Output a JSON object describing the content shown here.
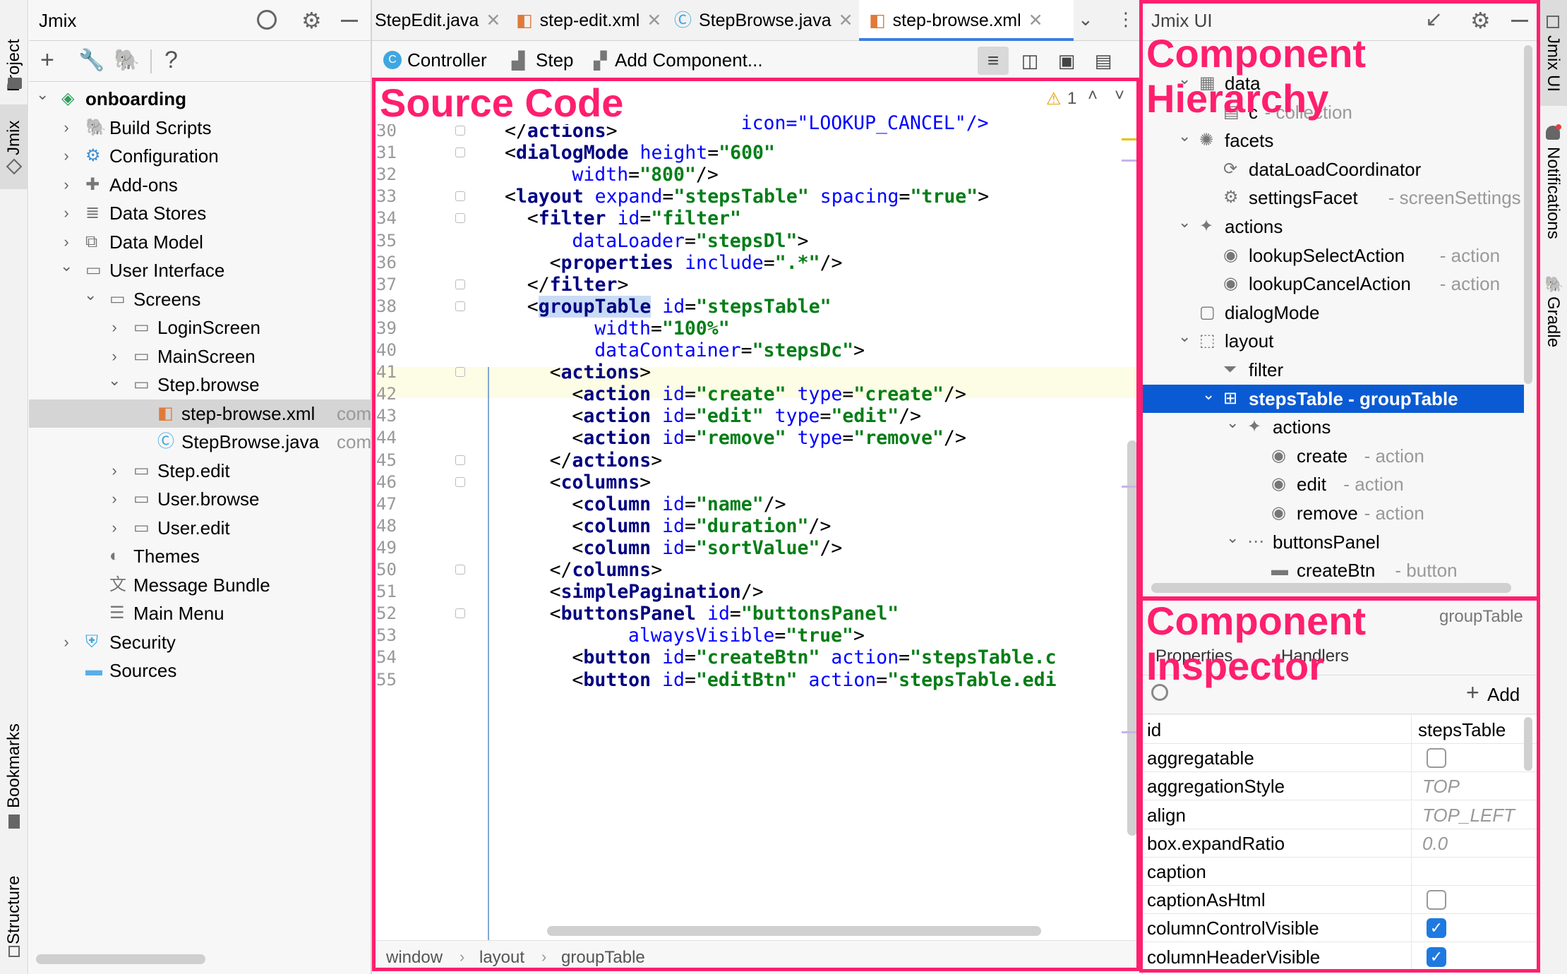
{
  "sidebar_left": {
    "project": "Project",
    "jmix": "Jmix",
    "bookmarks": "Bookmarks",
    "structure": "Structure"
  },
  "sidebar_right": {
    "jmix_ui": "Jmix UI",
    "notifications": "Notifications",
    "gradle": "Gradle"
  },
  "project_panel": {
    "title": "Jmix",
    "toolbar_help": "?",
    "tree": [
      {
        "label": "onboarding",
        "bold": true,
        "level": 0,
        "expanded": true,
        "icon": "project-icon"
      },
      {
        "label": "Build Scripts",
        "level": 1,
        "expanded": false,
        "icon": "gradle-icon"
      },
      {
        "label": "Configuration",
        "level": 1,
        "expanded": false,
        "icon": "config-icon"
      },
      {
        "label": "Add-ons",
        "level": 1,
        "expanded": false,
        "icon": "puzzle-icon"
      },
      {
        "label": "Data Stores",
        "level": 1,
        "expanded": false,
        "icon": "database-icon"
      },
      {
        "label": "Data Model",
        "level": 1,
        "expanded": false,
        "icon": "model-icon"
      },
      {
        "label": "User Interface",
        "level": 1,
        "expanded": true,
        "icon": "ui-icon"
      },
      {
        "label": "Screens",
        "level": 2,
        "expanded": true,
        "icon": "screen-icon"
      },
      {
        "label": "LoginScreen",
        "level": 3,
        "expanded": false,
        "icon": "screen-icon"
      },
      {
        "label": "MainScreen",
        "level": 3,
        "expanded": false,
        "icon": "screen-icon"
      },
      {
        "label": "Step.browse",
        "level": 3,
        "expanded": true,
        "icon": "screen-icon"
      },
      {
        "label": "step-browse.xml",
        "suffix": "com",
        "level": 4,
        "icon": "xml-icon",
        "selected": true
      },
      {
        "label": "StepBrowse.java",
        "suffix": "com",
        "level": 4,
        "icon": "class-icon"
      },
      {
        "label": "Step.edit",
        "level": 3,
        "expanded": false,
        "icon": "screen-icon"
      },
      {
        "label": "User.browse",
        "level": 3,
        "expanded": false,
        "icon": "screen-icon"
      },
      {
        "label": "User.edit",
        "level": 3,
        "expanded": false,
        "icon": "screen-icon"
      },
      {
        "label": "Themes",
        "level": 2,
        "icon": "themes-icon"
      },
      {
        "label": "Message Bundle",
        "level": 2,
        "icon": "translate-icon"
      },
      {
        "label": "Main Menu",
        "level": 2,
        "icon": "menu-icon"
      },
      {
        "label": "Security",
        "level": 1,
        "expanded": false,
        "icon": "shield-icon"
      },
      {
        "label": "Sources",
        "level": 1,
        "icon": "folder-icon"
      }
    ]
  },
  "editor_tabs": [
    {
      "label": "StepEdit.java",
      "icon": "class-icon"
    },
    {
      "label": "step-edit.xml",
      "icon": "xml-icon"
    },
    {
      "label": "StepBrowse.java",
      "icon": "class-icon"
    },
    {
      "label": "step-browse.xml",
      "icon": "xml-icon",
      "active": true
    }
  ],
  "editor_toolbar": {
    "controller": "Controller",
    "step": "Step",
    "add_component": "Add Component..."
  },
  "editor": {
    "warnings": "1",
    "top_fragment": "icon=\"LOOKUP_CANCEL\"/>",
    "lines": [
      {
        "n": "30",
        "indent": 0,
        "parts": [
          [
            "p",
            "</"
          ],
          [
            "t",
            "actions"
          ],
          [
            "p",
            ">"
          ]
        ]
      },
      {
        "n": "31",
        "indent": 0,
        "parts": [
          [
            "p",
            "<"
          ],
          [
            "t",
            "dialogMode"
          ],
          [
            "p",
            " "
          ],
          [
            "a",
            "height"
          ],
          [
            "p",
            "="
          ],
          [
            "v",
            "\"600\""
          ]
        ]
      },
      {
        "n": "32",
        "indent": 6,
        "parts": [
          [
            "a",
            "width"
          ],
          [
            "p",
            "="
          ],
          [
            "v",
            "\"800\""
          ],
          [
            "p",
            "/>"
          ]
        ]
      },
      {
        "n": "33",
        "indent": 0,
        "parts": [
          [
            "p",
            "<"
          ],
          [
            "t",
            "layout"
          ],
          [
            "p",
            " "
          ],
          [
            "a",
            "expand"
          ],
          [
            "p",
            "="
          ],
          [
            "v",
            "\"stepsTable\""
          ],
          [
            "p",
            " "
          ],
          [
            "a",
            "spacing"
          ],
          [
            "p",
            "="
          ],
          [
            "v",
            "\"true\""
          ],
          [
            "p",
            ">"
          ]
        ]
      },
      {
        "n": "34",
        "indent": 2,
        "parts": [
          [
            "p",
            "<"
          ],
          [
            "t",
            "filter"
          ],
          [
            "p",
            " "
          ],
          [
            "a",
            "id"
          ],
          [
            "p",
            "="
          ],
          [
            "v",
            "\"filter\""
          ]
        ]
      },
      {
        "n": "35",
        "indent": 6,
        "parts": [
          [
            "a",
            "dataLoader"
          ],
          [
            "p",
            "="
          ],
          [
            "v",
            "\"stepsDl\""
          ],
          [
            "p",
            ">"
          ]
        ]
      },
      {
        "n": "36",
        "indent": 4,
        "parts": [
          [
            "p",
            "<"
          ],
          [
            "t",
            "properties"
          ],
          [
            "p",
            " "
          ],
          [
            "a",
            "include"
          ],
          [
            "p",
            "="
          ],
          [
            "v",
            "\".*\""
          ],
          [
            "p",
            "/>"
          ]
        ]
      },
      {
        "n": "37",
        "indent": 2,
        "parts": [
          [
            "p",
            "</"
          ],
          [
            "t",
            "filter"
          ],
          [
            "p",
            ">"
          ]
        ]
      },
      {
        "n": "38",
        "indent": 2,
        "parts": [
          [
            "p",
            "<"
          ],
          [
            "t",
            "groupTable"
          ],
          [
            "p",
            " "
          ],
          [
            "a",
            "id"
          ],
          [
            "p",
            "="
          ],
          [
            "v",
            "\"stepsTable\""
          ]
        ]
      },
      {
        "n": "39",
        "indent": 8,
        "parts": [
          [
            "a",
            "width"
          ],
          [
            "p",
            "="
          ],
          [
            "v",
            "\"100%\""
          ]
        ]
      },
      {
        "n": "40",
        "indent": 8,
        "parts": [
          [
            "a",
            "dataContainer"
          ],
          [
            "p",
            "="
          ],
          [
            "v",
            "\"stepsDc\""
          ],
          [
            "p",
            ">"
          ]
        ]
      },
      {
        "n": "41",
        "indent": 4,
        "parts": [
          [
            "p",
            "<"
          ],
          [
            "t",
            "actions"
          ],
          [
            "p",
            ">"
          ]
        ]
      },
      {
        "n": "42",
        "indent": 6,
        "parts": [
          [
            "p",
            "<"
          ],
          [
            "t",
            "action"
          ],
          [
            "p",
            " "
          ],
          [
            "a",
            "id"
          ],
          [
            "p",
            "="
          ],
          [
            "v",
            "\"create\""
          ],
          [
            "p",
            " "
          ],
          [
            "a",
            "type"
          ],
          [
            "p",
            "="
          ],
          [
            "v",
            "\"create\""
          ],
          [
            "p",
            "/>"
          ]
        ]
      },
      {
        "n": "43",
        "indent": 6,
        "parts": [
          [
            "p",
            "<"
          ],
          [
            "t",
            "action"
          ],
          [
            "p",
            " "
          ],
          [
            "a",
            "id"
          ],
          [
            "p",
            "="
          ],
          [
            "v",
            "\"edit\""
          ],
          [
            "p",
            " "
          ],
          [
            "a",
            "type"
          ],
          [
            "p",
            "="
          ],
          [
            "v",
            "\"edit\""
          ],
          [
            "p",
            "/>"
          ]
        ]
      },
      {
        "n": "44",
        "indent": 6,
        "parts": [
          [
            "p",
            "<"
          ],
          [
            "t",
            "action"
          ],
          [
            "p",
            " "
          ],
          [
            "a",
            "id"
          ],
          [
            "p",
            "="
          ],
          [
            "v",
            "\"remove\""
          ],
          [
            "p",
            " "
          ],
          [
            "a",
            "type"
          ],
          [
            "p",
            "="
          ],
          [
            "v",
            "\"remove\""
          ],
          [
            "p",
            "/>"
          ]
        ]
      },
      {
        "n": "45",
        "indent": 4,
        "parts": [
          [
            "p",
            "</"
          ],
          [
            "t",
            "actions"
          ],
          [
            "p",
            ">"
          ]
        ]
      },
      {
        "n": "46",
        "indent": 4,
        "parts": [
          [
            "p",
            "<"
          ],
          [
            "t",
            "columns"
          ],
          [
            "p",
            ">"
          ]
        ]
      },
      {
        "n": "47",
        "indent": 6,
        "parts": [
          [
            "p",
            "<"
          ],
          [
            "t",
            "column"
          ],
          [
            "p",
            " "
          ],
          [
            "a",
            "id"
          ],
          [
            "p",
            "="
          ],
          [
            "v",
            "\"name\""
          ],
          [
            "p",
            "/>"
          ]
        ]
      },
      {
        "n": "48",
        "indent": 6,
        "parts": [
          [
            "p",
            "<"
          ],
          [
            "t",
            "column"
          ],
          [
            "p",
            " "
          ],
          [
            "a",
            "id"
          ],
          [
            "p",
            "="
          ],
          [
            "v",
            "\"duration\""
          ],
          [
            "p",
            "/>"
          ]
        ]
      },
      {
        "n": "49",
        "indent": 6,
        "parts": [
          [
            "p",
            "<"
          ],
          [
            "t",
            "column"
          ],
          [
            "p",
            " "
          ],
          [
            "a",
            "id"
          ],
          [
            "p",
            "="
          ],
          [
            "v",
            "\"sortValue\""
          ],
          [
            "p",
            "/>"
          ]
        ]
      },
      {
        "n": "50",
        "indent": 4,
        "parts": [
          [
            "p",
            "</"
          ],
          [
            "t",
            "columns"
          ],
          [
            "p",
            ">"
          ]
        ]
      },
      {
        "n": "51",
        "indent": 4,
        "parts": [
          [
            "p",
            "<"
          ],
          [
            "t",
            "simplePagination"
          ],
          [
            "p",
            "/>"
          ]
        ]
      },
      {
        "n": "52",
        "indent": 4,
        "parts": [
          [
            "p",
            "<"
          ],
          [
            "t",
            "buttonsPanel"
          ],
          [
            "p",
            " "
          ],
          [
            "a",
            "id"
          ],
          [
            "p",
            "="
          ],
          [
            "v",
            "\"buttonsPanel\""
          ]
        ]
      },
      {
        "n": "53",
        "indent": 11,
        "parts": [
          [
            "a",
            "alwaysVisible"
          ],
          [
            "p",
            "="
          ],
          [
            "v",
            "\"true\""
          ],
          [
            "p",
            ">"
          ]
        ]
      },
      {
        "n": "54",
        "indent": 6,
        "parts": [
          [
            "p",
            "<"
          ],
          [
            "t",
            "button"
          ],
          [
            "p",
            " "
          ],
          [
            "a",
            "id"
          ],
          [
            "p",
            "="
          ],
          [
            "v",
            "\"createBtn\""
          ],
          [
            "p",
            " "
          ],
          [
            "a",
            "action"
          ],
          [
            "p",
            "="
          ],
          [
            "v",
            "\"stepsTable.c"
          ]
        ]
      },
      {
        "n": "55",
        "indent": 6,
        "parts": [
          [
            "p",
            "<"
          ],
          [
            "t",
            "button"
          ],
          [
            "p",
            " "
          ],
          [
            "a",
            "id"
          ],
          [
            "p",
            "="
          ],
          [
            "v",
            "\"editBtn\""
          ],
          [
            "p",
            " "
          ],
          [
            "a",
            "action"
          ],
          [
            "p",
            "="
          ],
          [
            "v",
            "\"stepsTable.edi"
          ]
        ]
      }
    ],
    "breadcrumbs": [
      "window",
      "layout",
      "groupTable"
    ]
  },
  "hierarchy": {
    "title": "Jmix UI",
    "items": [
      {
        "label": "data",
        "level": 1,
        "expanded": true,
        "icon": "data-icon",
        "partial": true
      },
      {
        "label": "c",
        "suffix": "collection",
        "level": 2,
        "icon": "collection-icon",
        "partial": true
      },
      {
        "label": "facets",
        "level": 1,
        "expanded": true,
        "icon": "facets-icon"
      },
      {
        "label": "dataLoadCoordinator",
        "level": 2,
        "icon": "coordinator-icon"
      },
      {
        "label": "settingsFacet",
        "suffix": "screenSettings",
        "level": 2,
        "icon": "settings-facet-icon"
      },
      {
        "label": "actions",
        "level": 1,
        "expanded": true,
        "icon": "actions-icon"
      },
      {
        "label": "lookupSelectAction",
        "suffix": "action",
        "level": 2,
        "icon": "action-icon"
      },
      {
        "label": "lookupCancelAction",
        "suffix": "action",
        "level": 2,
        "icon": "action-icon"
      },
      {
        "label": "dialogMode",
        "level": 1,
        "icon": "dialog-icon"
      },
      {
        "label": "layout",
        "level": 1,
        "expanded": true,
        "icon": "layout-icon"
      },
      {
        "label": "filter",
        "level": 2,
        "icon": "filter-icon"
      },
      {
        "label": "stepsTable - groupTable",
        "level": 2,
        "expanded": true,
        "icon": "table-icon",
        "selected": true
      },
      {
        "label": "actions",
        "level": 3,
        "expanded": true,
        "icon": "actions-icon"
      },
      {
        "label": "create",
        "suffix": "action",
        "level": 4,
        "icon": "action-icon"
      },
      {
        "label": "edit",
        "suffix": "action",
        "level": 4,
        "icon": "action-icon"
      },
      {
        "label": "remove",
        "suffix": "action",
        "level": 4,
        "icon": "action-icon"
      },
      {
        "label": "buttonsPanel",
        "level": 3,
        "expanded": true,
        "icon": "panel-icon"
      },
      {
        "label": "createBtn",
        "suffix": "button",
        "level": 4,
        "icon": "button-icon"
      }
    ]
  },
  "inspector": {
    "component_type": "groupTable",
    "tab_properties": "Properties",
    "tab_handlers": "Handlers",
    "add_label": "Add",
    "properties": [
      {
        "name": "id",
        "value": "stepsTable",
        "kind": "text"
      },
      {
        "name": "aggregatable",
        "value": false,
        "kind": "checkbox"
      },
      {
        "name": "aggregationStyle",
        "value": "TOP",
        "kind": "default"
      },
      {
        "name": "align",
        "value": "TOP_LEFT",
        "kind": "default"
      },
      {
        "name": "box.expandRatio",
        "value": "0.0",
        "kind": "default"
      },
      {
        "name": "caption",
        "value": "",
        "kind": "text"
      },
      {
        "name": "captionAsHtml",
        "value": false,
        "kind": "checkbox"
      },
      {
        "name": "columnControlVisible",
        "value": true,
        "kind": "checkbox"
      },
      {
        "name": "columnHeaderVisible",
        "value": true,
        "kind": "checkbox"
      }
    ]
  },
  "annotations": {
    "source_code": "Source Code",
    "hierarchy_line1": "Component",
    "hierarchy_line2": "Hierarchy",
    "inspector_line1": "Component",
    "inspector_line2": "Inspector"
  },
  "colors": {
    "accent": "#ff1f6e",
    "selection": "#0a5bd3",
    "tag": "#000080",
    "attr": "#0000ff",
    "value": "#067d17"
  }
}
